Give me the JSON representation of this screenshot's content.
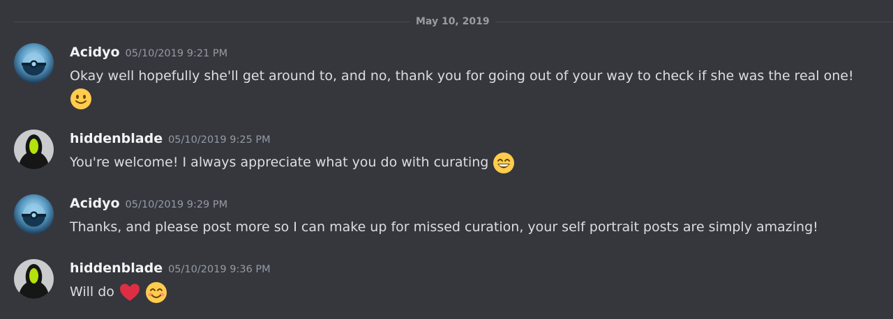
{
  "date_divider": "May 10, 2019",
  "messages": [
    {
      "username": "Acidyo",
      "timestamp": "05/10/2019 9:21 PM",
      "text": "Okay well hopefully she'll get around to, and no, thank you for going out of your way to check if she was the real one!",
      "avatar": "pokeball-avatar",
      "emoji": [
        "slightly-smiling-face"
      ]
    },
    {
      "username": "hiddenblade",
      "timestamp": "05/10/2019 9:25 PM",
      "text": "You're welcome! I always appreciate what you do with curating",
      "avatar": "hooded-figure-avatar",
      "emoji": [
        "grinning-face-with-smiling-eyes"
      ]
    },
    {
      "username": "Acidyo",
      "timestamp": "05/10/2019 9:29 PM",
      "text": "Thanks, and please post more so I can make up for missed curation, your self portrait posts are simply amazing!",
      "avatar": "pokeball-avatar",
      "emoji": []
    },
    {
      "username": "hiddenblade",
      "timestamp": "05/10/2019 9:36 PM",
      "text": "Will do",
      "avatar": "hooded-figure-avatar",
      "emoji": [
        "red-heart",
        "smiling-face-with-smiling-eyes"
      ]
    }
  ],
  "colors": {
    "background": "#36373d",
    "username": "#f2f3f5",
    "timestamp": "#949ba4",
    "message_text": "#dbdee1",
    "divider": "#4a4b52"
  }
}
